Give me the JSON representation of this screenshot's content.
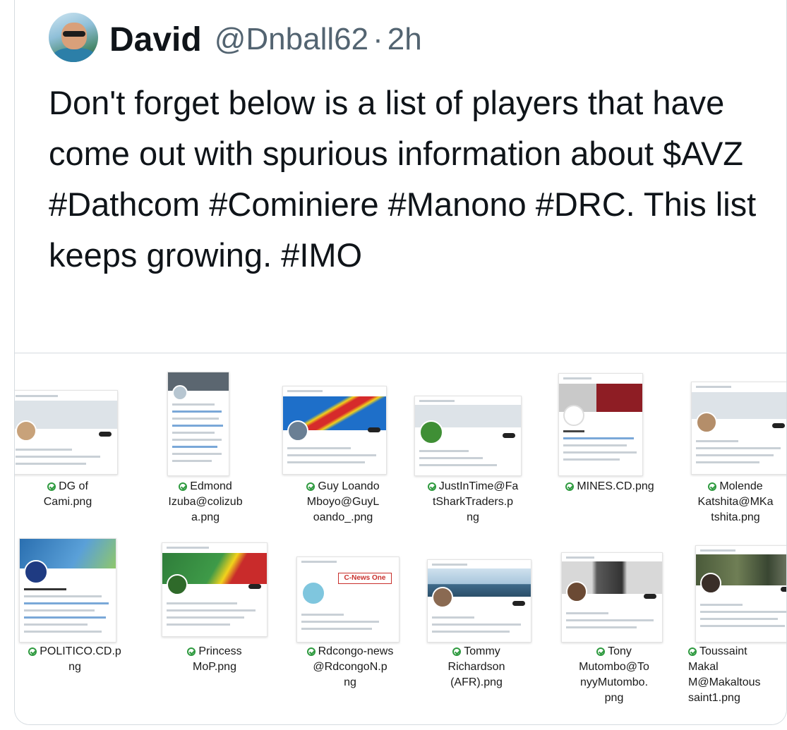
{
  "tweet": {
    "author_name": "David",
    "author_handle": "@Dnball62",
    "separator": "·",
    "time": "2h",
    "text": "Don't forget below is a list of players that have come out with spurious information about $AVZ #Dathcom #Cominiere #Manono #DRC. This list keeps growing. #IMO"
  },
  "media": {
    "files": [
      {
        "caption": "DG of\nCami.png"
      },
      {
        "caption": "Edmond\nIzuba@colizub\na.png"
      },
      {
        "caption": "Guy Loando\nMboyo@GuyL\noando_.png"
      },
      {
        "caption": "JustInTime@Fa\ntSharkTraders.p\nng"
      },
      {
        "caption": "MINES.CD.png"
      },
      {
        "caption": "Molende\nKatshita@MKa\ntshita.png"
      },
      {
        "caption": "POLITICO.CD.p\nng"
      },
      {
        "caption": "Princess\nMoP.png"
      },
      {
        "caption": "Rdcongo-news\n@RdcongoN.p\nng"
      },
      {
        "caption": "Tommy\nRichardson\n(AFR).png"
      },
      {
        "caption": "Tony\nMutombo@To\nnyyMutombo.\npng"
      },
      {
        "caption": "Toussaint\nMakal\nM@Makaltous\nsaint1.png"
      }
    ]
  },
  "colors": {
    "check_green": "#2e9a3f",
    "handle_gray": "#536471",
    "text": "#0f1419"
  }
}
